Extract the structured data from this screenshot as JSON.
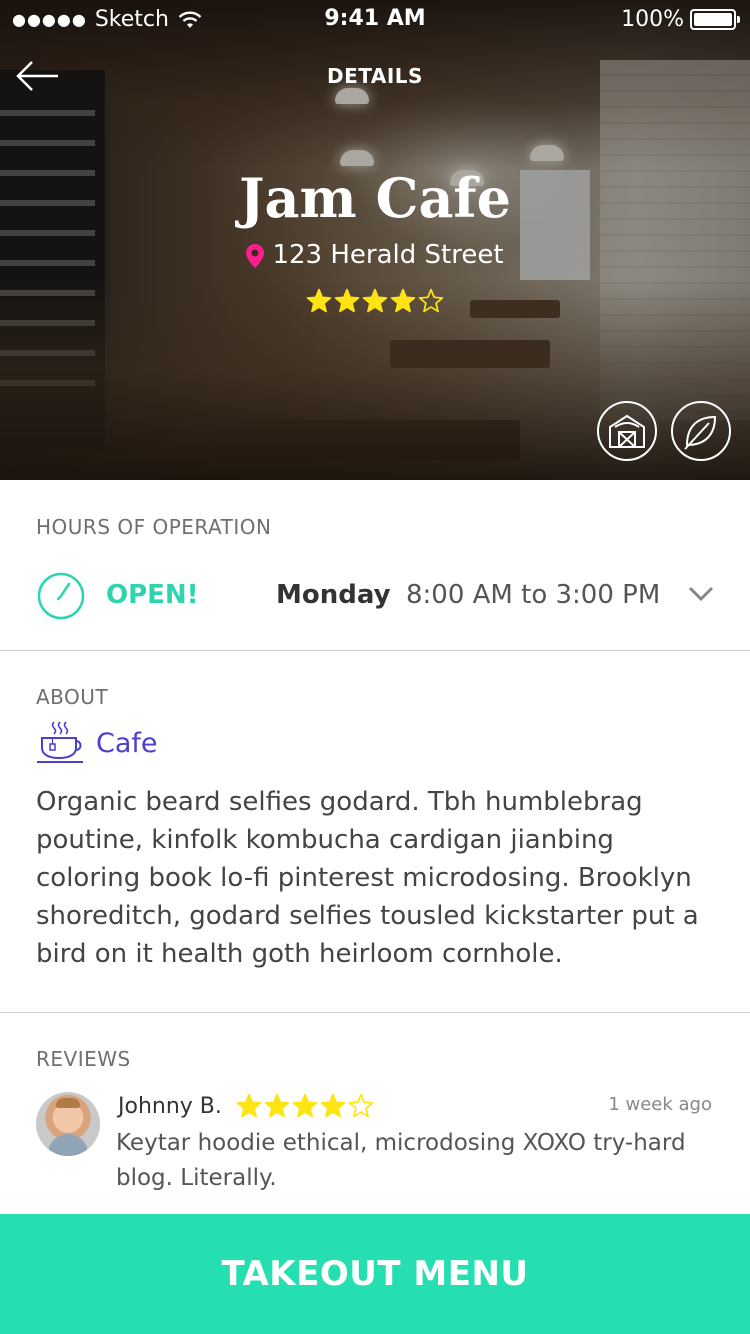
{
  "status_bar": {
    "signal_dots": "●●●●●",
    "carrier": "Sketch",
    "time": "9:41 AM",
    "battery": "100%"
  },
  "nav": {
    "title": "DETAILS"
  },
  "place": {
    "name": "Jam Cafe",
    "address": "123 Herald Street",
    "rating": 4,
    "rating_max": 5
  },
  "badges": [
    "barn-icon",
    "leaf-icon"
  ],
  "hours": {
    "section_title": "HOURS OF OPERATION",
    "status": "OPEN!",
    "day": "Monday",
    "time_range": "8:00 AM to 3:00 PM"
  },
  "about": {
    "section_title": "ABOUT",
    "category": "Cafe",
    "description": "Organic beard selfies godard. Tbh humblebrag poutine, kinfolk kombucha cardigan jianbing coloring book lo-fi pinterest microdosing. Brooklyn shoreditch, godard selfies tousled kickstarter put a bird on it health goth heirloom cornhole."
  },
  "reviews": {
    "section_title": "REVIEWS",
    "items": [
      {
        "author": "Johnny B.",
        "rating": 4,
        "rating_max": 5,
        "time": "1 week ago",
        "text": "Keytar hoodie ethical, microdosing XOXO try-hard blog. Literally."
      }
    ]
  },
  "cta": {
    "label": "TAKEOUT MENU"
  },
  "colors": {
    "accent": "#25dfb1",
    "open": "#2ed3b0",
    "category": "#4a3fcf",
    "star": "#ffe414",
    "pin": "#ff1e8c"
  }
}
